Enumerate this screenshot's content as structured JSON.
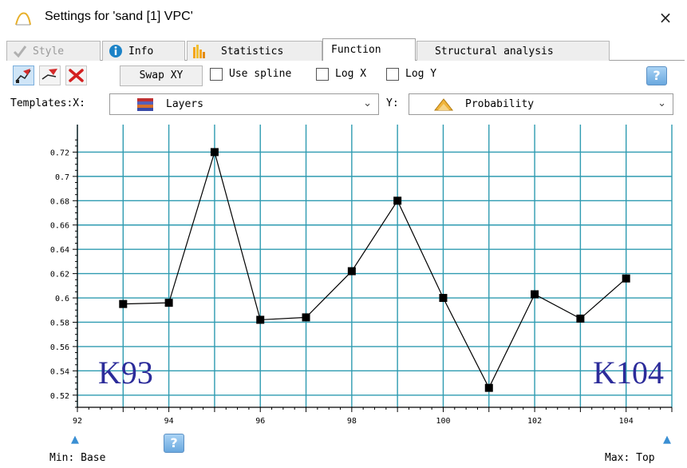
{
  "window": {
    "title": "Settings for 'sand [1] VPC'",
    "close_label": "×"
  },
  "tabs": [
    {
      "label": "Style",
      "state": "disabled",
      "icon": "pen-check-icon"
    },
    {
      "label": "Info",
      "state": "normal",
      "icon": "info-icon"
    },
    {
      "label": "Statistics",
      "state": "normal",
      "icon": "bar-chart-icon"
    },
    {
      "label": "Function",
      "state": "active",
      "icon": ""
    },
    {
      "label": "Structural analysis",
      "state": "normal",
      "icon": ""
    }
  ],
  "toolbar": {
    "swap_label": "Swap XY",
    "use_spline_label": "Use spline",
    "log_x_label": "Log X",
    "log_y_label": "Log Y",
    "use_spline_checked": false,
    "log_x_checked": false,
    "log_y_checked": false,
    "help_label": "?"
  },
  "templates": {
    "label": "Templates:X:",
    "x_value": "Layers",
    "y_label": "Y:",
    "y_value": "Probability"
  },
  "chart_data": {
    "type": "line",
    "x": [
      93,
      94,
      95,
      96,
      97,
      98,
      99,
      100,
      101,
      102,
      103,
      104
    ],
    "values": [
      0.595,
      0.596,
      0.72,
      0.582,
      0.584,
      0.622,
      0.68,
      0.6,
      0.526,
      0.603,
      0.583,
      0.616
    ],
    "xlim": [
      92,
      105
    ],
    "ylim": [
      0.51,
      0.74
    ],
    "xticks": [
      92,
      94,
      96,
      98,
      100,
      102,
      104
    ],
    "yticks": [
      0.52,
      0.54,
      0.56,
      0.58,
      0.6,
      0.62,
      0.64,
      0.66,
      0.68,
      0.7,
      0.72
    ],
    "ytick_labels": [
      "0.52",
      "0.54",
      "0.56",
      "0.58",
      "0.6",
      "0.62",
      "0.64",
      "0.66",
      "0.68",
      "0.7",
      "0.72"
    ],
    "grid": true,
    "annotations": [
      {
        "text": "K93",
        "anchor": "bottom-left"
      },
      {
        "text": "K104",
        "anchor": "bottom-right"
      }
    ],
    "grid_color": "#2e9bb1",
    "line_color": "#000000"
  },
  "footer": {
    "min_label": "Min: Base",
    "max_label": "Max: Top",
    "help_label": "?"
  }
}
